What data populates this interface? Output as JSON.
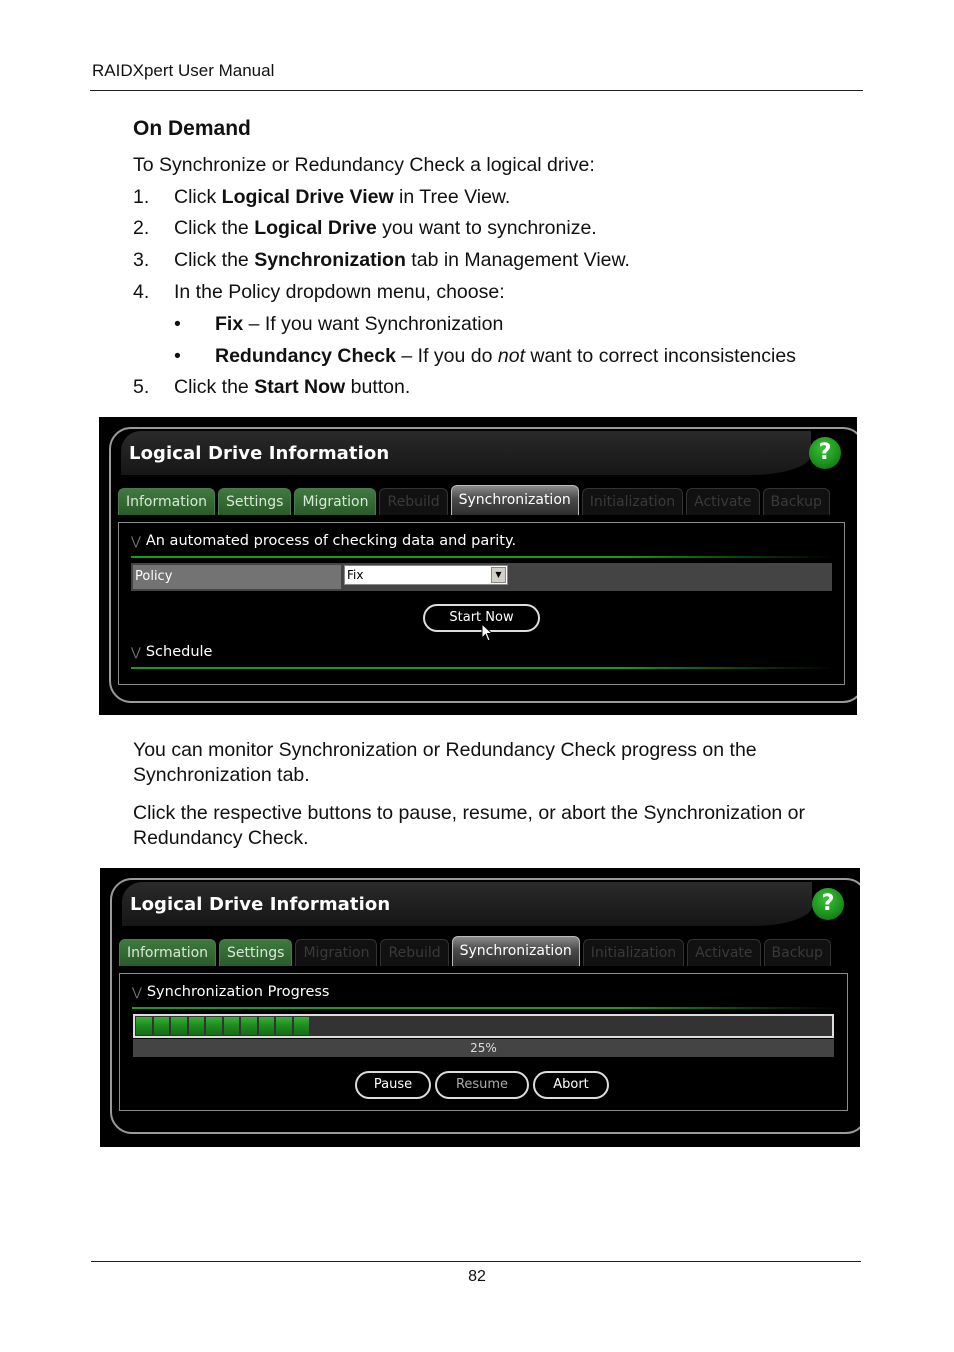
{
  "document": {
    "running_header": "RAIDXpert User Manual",
    "section_title": "On Demand",
    "intro": "To Synchronize or Redundancy Check a logical drive:",
    "steps": [
      {
        "num": "1.",
        "pre": "Click ",
        "bold": "Logical Drive View",
        "post": " in Tree View."
      },
      {
        "num": "2.",
        "pre": "Click the ",
        "bold": "Logical Drive",
        "post": " you want to synchronize."
      },
      {
        "num": "3.",
        "pre": "Click the ",
        "bold": "Synchronization",
        "post": " tab in Management View."
      },
      {
        "num": "4.",
        "pre": "In the Policy dropdown menu, choose:",
        "bold": "",
        "post": ""
      },
      {
        "num": "5.",
        "pre": "Click the ",
        "bold": "Start Now",
        "post": " button."
      }
    ],
    "bullets": [
      {
        "symbol": "•",
        "bold": "Fix",
        "pre": " – If you want Synchronization",
        "italic": "",
        "post": ""
      },
      {
        "symbol": "•",
        "bold": "Redundancy Check",
        "pre": " – If you do ",
        "italic": "not",
        "post": " want to correct inconsistencies"
      }
    ],
    "paragraphs": [
      "You can monitor Synchronization or Redundancy Check progress on the Synchronization tab.",
      "Click the respective buttons to pause, resume, or abort the Synchronization or Redundancy Check."
    ],
    "page_number": "82"
  },
  "screenshot_1": {
    "title": "Logical Drive Information",
    "help_icon": "?",
    "tabs": [
      {
        "label": "Information",
        "state": "enabled"
      },
      {
        "label": "Settings",
        "state": "enabled"
      },
      {
        "label": "Migration",
        "state": "enabled"
      },
      {
        "label": "Rebuild",
        "state": "disabled"
      },
      {
        "label": "Synchronization",
        "state": "active"
      },
      {
        "label": "Initialization",
        "state": "disabled"
      },
      {
        "label": "Activate",
        "state": "disabled"
      },
      {
        "label": "Backup",
        "state": "disabled"
      }
    ],
    "section_head": "An automated process of checking data and parity.",
    "policy_label": "Policy",
    "policy_value": "Fix",
    "start_button": "Start Now",
    "schedule_head": "Schedule"
  },
  "screenshot_2": {
    "title": "Logical Drive Information",
    "help_icon": "?",
    "tabs": [
      {
        "label": "Information",
        "state": "enabled"
      },
      {
        "label": "Settings",
        "state": "enabled"
      },
      {
        "label": "Migration",
        "state": "disabled"
      },
      {
        "label": "Rebuild",
        "state": "disabled"
      },
      {
        "label": "Synchronization",
        "state": "active"
      },
      {
        "label": "Initialization",
        "state": "disabled"
      },
      {
        "label": "Activate",
        "state": "disabled"
      },
      {
        "label": "Backup",
        "state": "disabled"
      }
    ],
    "section_head": "Synchronization Progress",
    "progress_percent": 25,
    "progress_label": "25%",
    "buttons": {
      "pause": "Pause",
      "resume": "Resume",
      "abort": "Abort"
    }
  }
}
